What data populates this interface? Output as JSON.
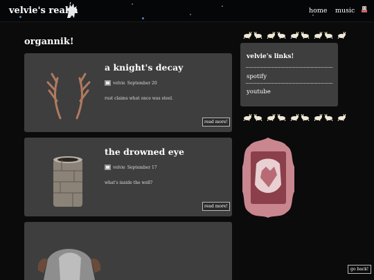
{
  "site": {
    "name": "velvie's realm",
    "logo_icon": "unicorn-icon"
  },
  "nav": {
    "home": "home",
    "music": "music",
    "extra_icon": "pixel-icon"
  },
  "section_title": "organnik!",
  "posts": [
    {
      "title": "a knight's decay",
      "author": "velvie",
      "date": "September 20",
      "excerpt": "rust claims what once was steel.",
      "read_more": "read more!",
      "thumb_icon": "antlers-image"
    },
    {
      "title": "the drowned eye",
      "author": "velvie",
      "date": "September 17",
      "excerpt": "what's inside the well?",
      "read_more": "read more!",
      "thumb_icon": "stone-well-image"
    },
    {
      "thumb_icon": "armor-image"
    }
  ],
  "sidebar": {
    "links_title": "velvie's links!",
    "links": [
      "spotify",
      "youtube"
    ],
    "art_icon": "ornate-frame-image"
  },
  "back_button": "go back!",
  "colors": {
    "background": "#0b0b0b",
    "card": "#3e3e3e",
    "star": "#6fa3d8"
  }
}
